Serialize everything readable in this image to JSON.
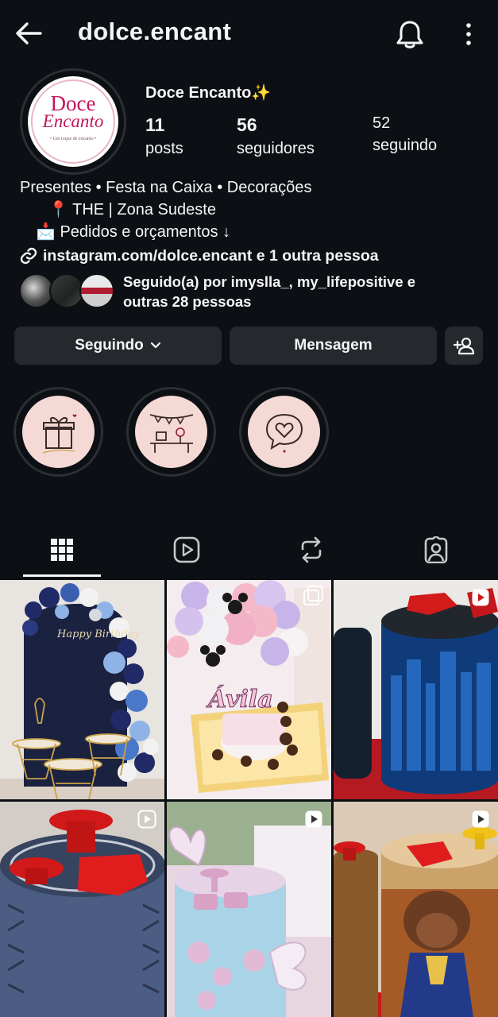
{
  "header": {
    "username": "dolce.encant"
  },
  "profile": {
    "display_name": "Doce Encanto✨",
    "avatar_text": {
      "line1": "Doce",
      "line2": "Encanto",
      "tagline": "• Um toque de encanto •"
    },
    "stats": {
      "posts": {
        "value": "11",
        "label": "posts"
      },
      "followers": {
        "value": "56",
        "label": "seguidores"
      },
      "following": {
        "value": "52",
        "label": "seguindo"
      }
    },
    "bio": {
      "line1": "Presentes • Festa na Caixa • Decorações",
      "line2": "📍 THE | Zona Sudeste",
      "line3": "📩 Pedidos e orçamentos ↓"
    },
    "link": "instagram.com/dolce.encant e 1 outra pessoa",
    "followed_by": {
      "line1": "Seguido(a) por imyslla_, my_lifepositive e",
      "line2": "outras 28 pessoas"
    }
  },
  "actions": {
    "following_label": "Seguindo",
    "message_label": "Mensagem"
  },
  "highlights": [
    {
      "icon": "gift-icon"
    },
    {
      "icon": "party-table-icon"
    },
    {
      "icon": "heart-chat-icon"
    }
  ],
  "tabs": [
    {
      "icon": "grid-icon",
      "active": true
    },
    {
      "icon": "reels-icon",
      "active": false
    },
    {
      "icon": "repost-icon",
      "active": false
    },
    {
      "icon": "tagged-icon",
      "active": false
    }
  ],
  "posts": [
    {
      "caption": "Happy Birthday",
      "type": "photo"
    },
    {
      "caption": "Ávila",
      "type": "carousel"
    },
    {
      "caption": "",
      "type": "reel"
    },
    {
      "caption": "",
      "type": "reel"
    },
    {
      "caption": "",
      "type": "reel"
    },
    {
      "caption": "",
      "type": "reel"
    }
  ],
  "colors": {
    "background": "#0c1014",
    "button": "#25292e",
    "brand_pink": "#c2185b"
  }
}
